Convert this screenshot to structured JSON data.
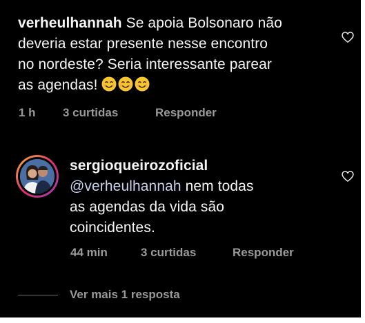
{
  "comment1": {
    "username": "verheulhannah",
    "text_line1": " Se apoia Bolsonaro não",
    "text_line2": "deveria estar presente nesse encontro",
    "text_line3": "no nordeste? Seria interessante parear",
    "text_line4": "as agendas! ",
    "emojis": [
      "smiling-face-icon",
      "smiling-face-icon",
      "smiling-face-icon"
    ],
    "time": "1 h",
    "likes": "3 curtidas",
    "reply": "Responder"
  },
  "comment2": {
    "username": "sergioqueirozoficial",
    "mention": "@verheulhannah",
    "text_line1_rest": " nem todas",
    "text_line2": "as agendas da vida são",
    "text_line3": "coincidentes.",
    "time": "44 min",
    "likes": "3 curtidas",
    "reply": "Responder"
  },
  "view_more": "Ver mais 1 resposta",
  "colors": {
    "background": "#000000",
    "text": "#f5f5f5",
    "meta": "#9a9a9a",
    "mention": "#c7d3ea",
    "emoji": "#f7c531"
  }
}
